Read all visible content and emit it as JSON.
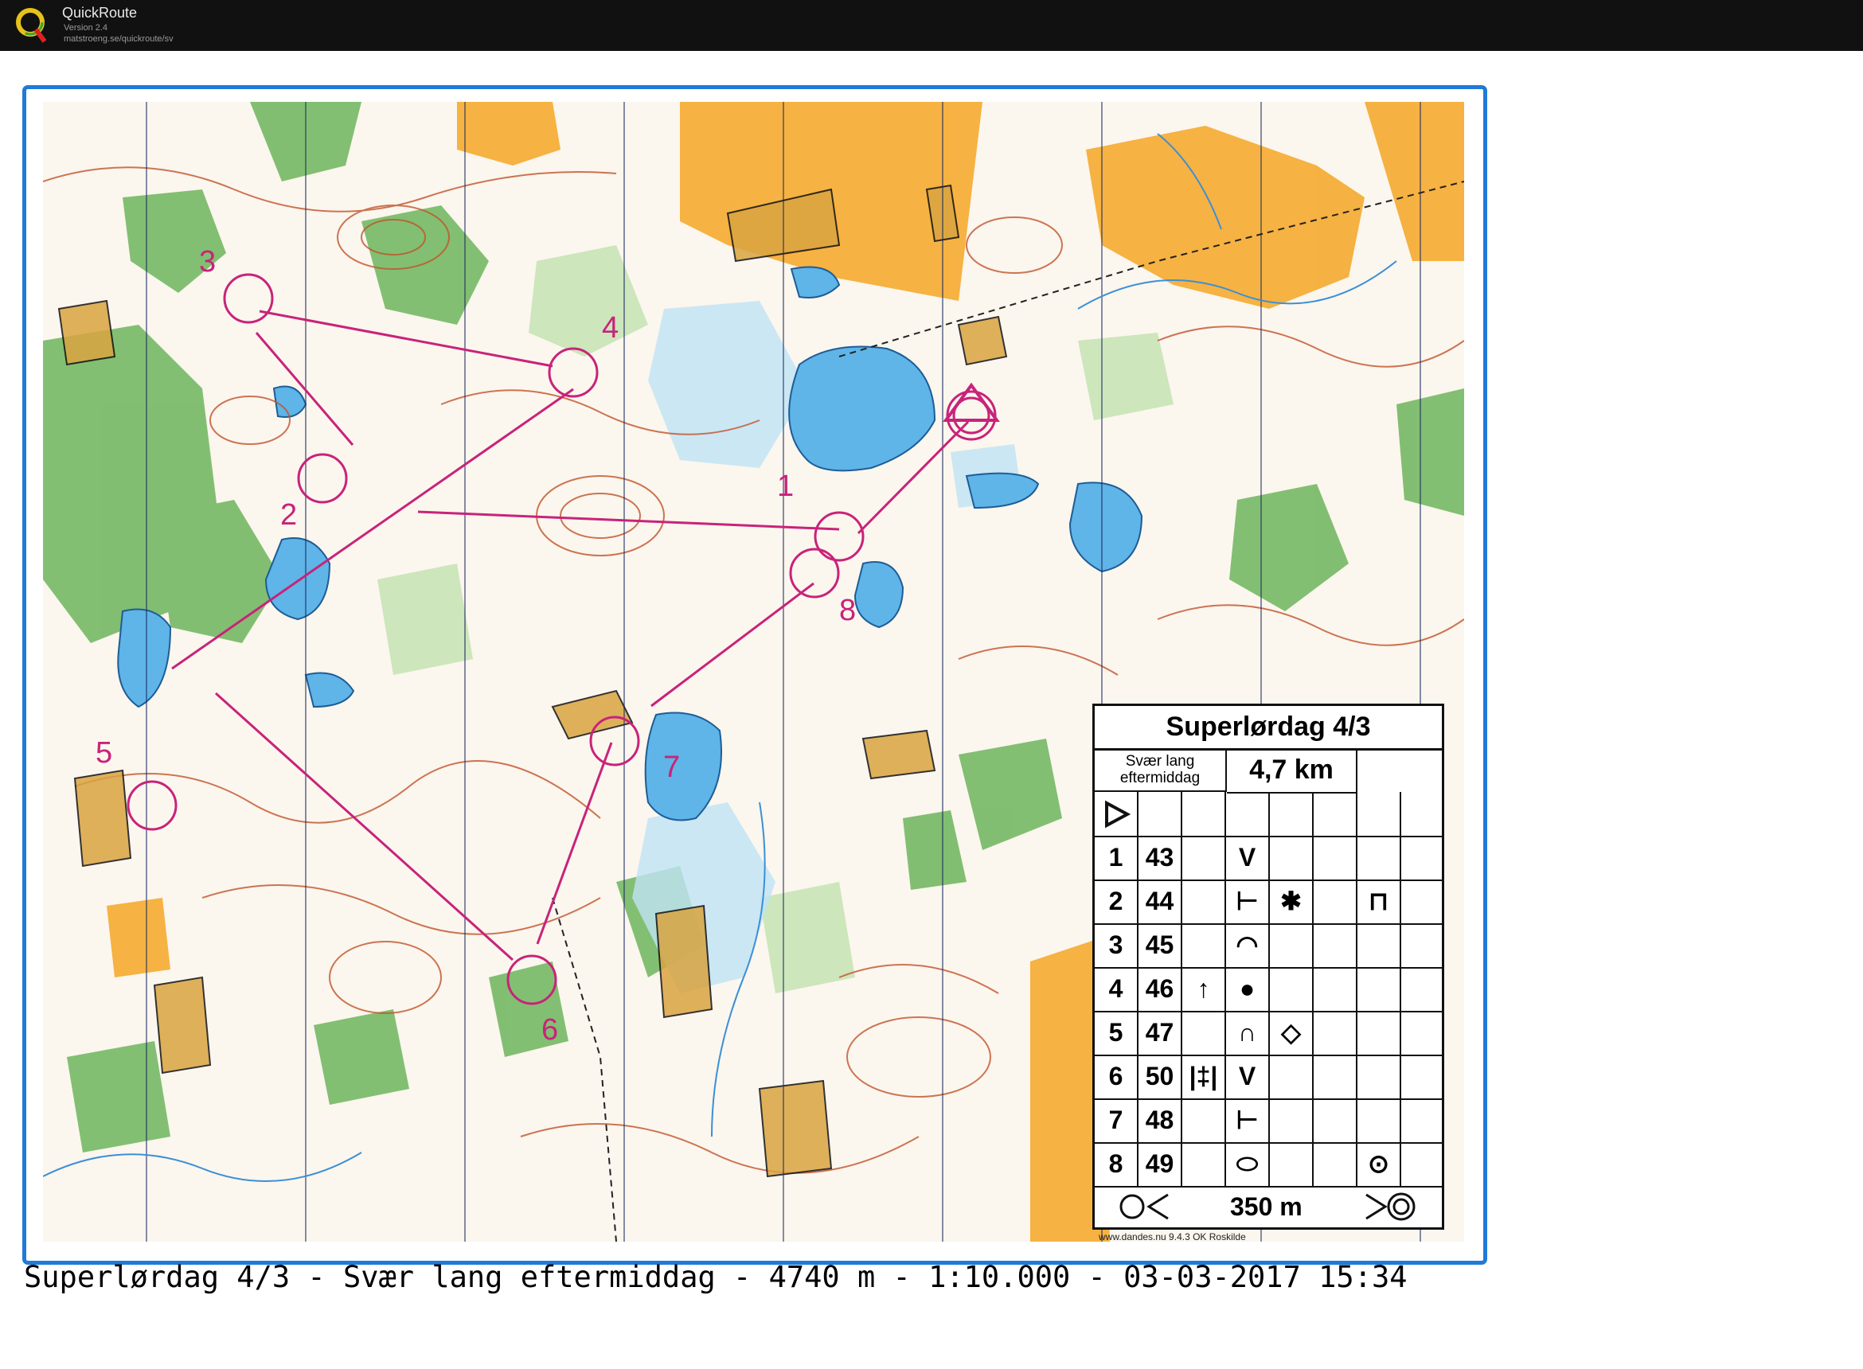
{
  "app": {
    "title": "QuickRoute",
    "version": "Version 2.4",
    "url": "matstroeng.se/quickroute/sv",
    "logo_icon": "quickroute-q-logo"
  },
  "caption": "Superlørdag 4/3 - Svær lang eftermiddag - 4740 m - 1:10.000 - 03-03-2017 15:34",
  "map_credit": "www.dandes.nu 9.4.3 OK Roskilde",
  "control_description": {
    "title": "Superlørdag 4/3",
    "class_line1": "Svær lang",
    "class_line2": "eftermiddag",
    "length": "4,7 km",
    "rows": [
      {
        "num": "1",
        "code": "43"
      },
      {
        "num": "2",
        "code": "44"
      },
      {
        "num": "3",
        "code": "45"
      },
      {
        "num": "4",
        "code": "46"
      },
      {
        "num": "5",
        "code": "47"
      },
      {
        "num": "6",
        "code": "50"
      },
      {
        "num": "7",
        "code": "48"
      },
      {
        "num": "8",
        "code": "49"
      }
    ],
    "finish_distance": "350 m"
  },
  "course": {
    "color": "#c8237a",
    "control_labels": [
      "1",
      "2",
      "3",
      "4",
      "5",
      "6",
      "7",
      "8"
    ]
  },
  "colors": {
    "frame": "#1f7ad8",
    "water": "#5fb4e8",
    "forest_green": "#5aac48",
    "open_yellow": "#f5a623",
    "contour": "#c0542a"
  }
}
